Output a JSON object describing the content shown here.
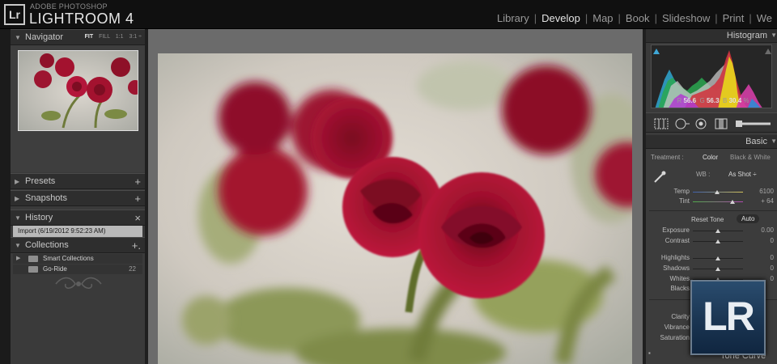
{
  "app": {
    "logo_text": "Lr",
    "brand_top": "ADOBE PHOTOSHOP",
    "brand_main": "LIGHTROOM 4"
  },
  "modules": [
    {
      "label": "Library",
      "active": false
    },
    {
      "label": "Develop",
      "active": true
    },
    {
      "label": "Map",
      "active": false
    },
    {
      "label": "Book",
      "active": false
    },
    {
      "label": "Slideshow",
      "active": false
    },
    {
      "label": "Print",
      "active": false
    },
    {
      "label": "We",
      "active": false
    }
  ],
  "left_panel": {
    "navigator": {
      "title": "Navigator",
      "modes": [
        "FIT",
        "FILL",
        "1:1",
        "3:1 ÷"
      ],
      "active_mode": "FIT"
    },
    "presets": {
      "title": "Presets",
      "action": "+"
    },
    "snapshots": {
      "title": "Snapshots",
      "action": "+"
    },
    "history": {
      "title": "History",
      "action": "×",
      "items": [
        "Import (6/19/2012 9:52:23 AM)"
      ]
    },
    "collections": {
      "title": "Collections",
      "action": "+.",
      "items": [
        {
          "label": "Smart Collections",
          "count": ""
        },
        {
          "label": "Go-Ride",
          "count": "22"
        }
      ]
    }
  },
  "right_panel": {
    "histogram": {
      "title": "Histogram",
      "r_label": "R",
      "r_value": "56.6",
      "g_label": "G",
      "g_value": "56.3",
      "b_label": "B",
      "b_value": "30.4",
      "unit": "%"
    },
    "basic": {
      "title": "Basic",
      "treatment_label": "Treatment :",
      "treatment_color": "Color",
      "treatment_bw": "Black & White",
      "wb_label": "WB :",
      "wb_value": "As Shot ÷",
      "temp_label": "Temp",
      "temp_value": "6100",
      "tint_label": "Tint",
      "tint_value": "+ 64",
      "reset_tone": "Reset Tone",
      "auto": "Auto",
      "exposure_label": "Exposure",
      "exposure_value": "0.00",
      "contrast_label": "Contrast",
      "contrast_value": "0",
      "highlights_label": "Highlights",
      "highlights_value": "0",
      "shadows_label": "Shadows",
      "shadows_value": "0",
      "whites_label": "Whites",
      "whites_value": "0",
      "blacks_label": "Blacks",
      "clarity_label": "Clarity",
      "vibrance_label": "Vibrance",
      "saturation_label": "Saturation"
    },
    "tone_curve": {
      "title": "Tone Curve"
    }
  },
  "badge": {
    "text": "LR"
  },
  "colors": {
    "accent_rose": "#a3122f",
    "panel_bg": "#3a3a3a",
    "top_bar": "#101010",
    "badge_blue": "#1a3552"
  }
}
